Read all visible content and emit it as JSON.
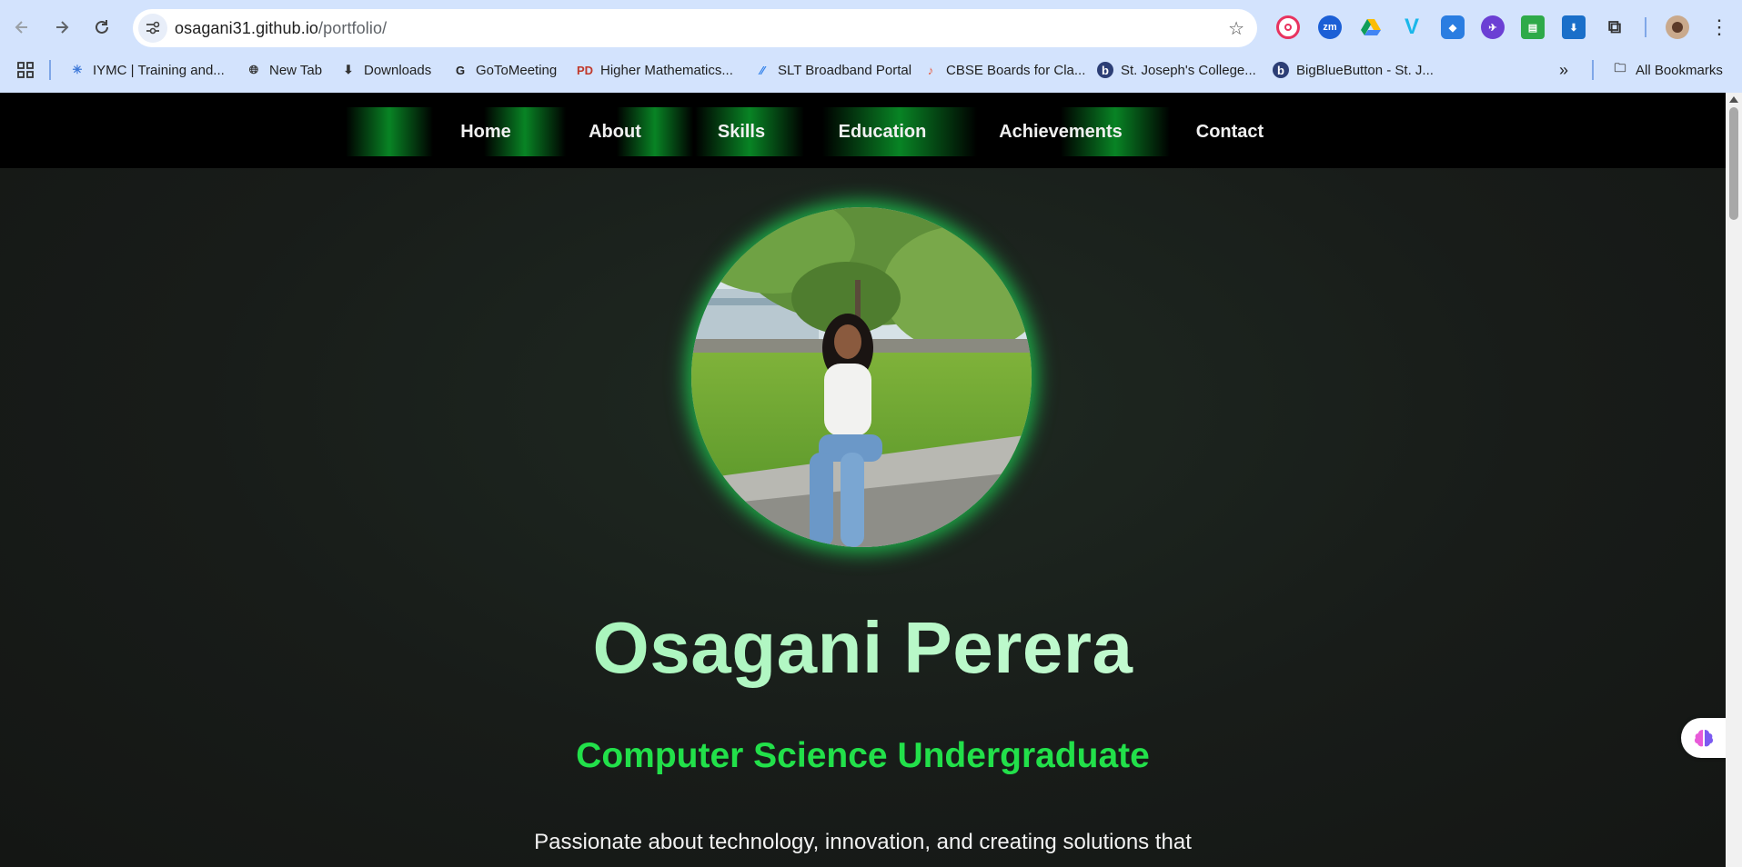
{
  "browser": {
    "url_host": "osagani31.github.io",
    "url_path": "/portfolio/",
    "bookmarks": [
      {
        "label": "IYMC | Training and...",
        "icon": "iymc-icon"
      },
      {
        "label": "New Tab",
        "icon": "globe-icon"
      },
      {
        "label": "Downloads",
        "icon": "download-icon"
      },
      {
        "label": "GoToMeeting",
        "icon": "gotomeeting-icon"
      },
      {
        "label": "Higher Mathematics...",
        "icon": "pd-icon"
      },
      {
        "label": "SLT Broadband Portal",
        "icon": "slt-icon"
      },
      {
        "label": "CBSE Boards for Cla...",
        "icon": "cbse-icon"
      },
      {
        "label": "St. Joseph's College...",
        "icon": "bigbluebutton-icon"
      },
      {
        "label": "BigBlueButton - St. J...",
        "icon": "bigbluebutton-icon"
      }
    ],
    "all_bookmarks": "All Bookmarks",
    "extensions": [
      "target-extension-icon",
      "zoom-extension-icon",
      "drive-extension-icon",
      "vimeo-extension-icon",
      "layers-extension-icon",
      "rocket-extension-icon",
      "sheet-extension-icon",
      "download-extension-icon",
      "puzzle-extensions-icon"
    ]
  },
  "nav": {
    "items": [
      "Home",
      "About",
      "Skills",
      "Education",
      "Achievements",
      "Contact"
    ]
  },
  "hero": {
    "name": "Osagani Perera",
    "subtitle": "Computer Science Undergraduate",
    "intro": "Passionate about technology, innovation, and creating solutions that"
  },
  "colors": {
    "accent_green": "#22e04a",
    "nav_glow": "#0a9b2b",
    "name_gradient_start": "#8ff0a8",
    "name_gradient_end": "#dcffe4",
    "chrome_bg": "#d3e3fd"
  }
}
